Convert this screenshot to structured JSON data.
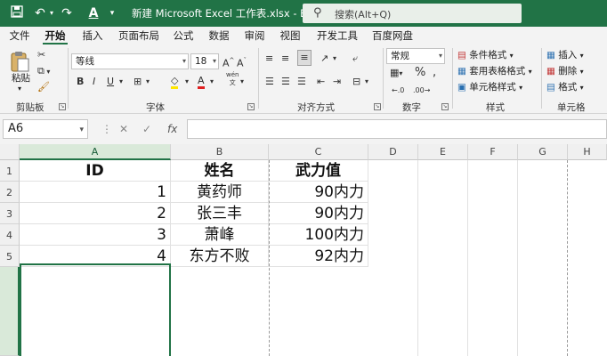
{
  "titlebar": {
    "title": "新建 Microsoft Excel 工作表.xlsx  -  Excel",
    "search_placeholder": "搜索(Alt+Q)",
    "icons": [
      "save-icon",
      "undo-icon",
      "redo-icon",
      "font-color-icon",
      "customize-qat-icon",
      "search-icon"
    ]
  },
  "tabs": [
    "文件",
    "开始",
    "插入",
    "页面布局",
    "公式",
    "数据",
    "审阅",
    "视图",
    "开发工具",
    "百度网盘"
  ],
  "active_tab": "开始",
  "ribbon": {
    "clipboard": {
      "paste": "粘贴",
      "label": "剪贴板"
    },
    "font": {
      "name": "等线",
      "size": "18",
      "label": "字体",
      "wen": "wén"
    },
    "alignment": {
      "label": "对齐方式"
    },
    "number": {
      "format": "常规",
      "label": "数字"
    },
    "styles": {
      "conditional": "条件格式",
      "table": "套用表格格式",
      "cell": "单元格样式",
      "label": "样式"
    },
    "cells": {
      "insert": "插入",
      "delete": "删除",
      "format": "格式",
      "label": "单元格"
    }
  },
  "formula_bar": {
    "name_box": "A6",
    "fx": "fx",
    "cancel": "✕",
    "enter": "✓",
    "value": ""
  },
  "grid": {
    "columns": [
      "A",
      "B",
      "C",
      "D",
      "E",
      "F",
      "G",
      "H"
    ],
    "rows": [
      "1",
      "2",
      "3",
      "4",
      "5"
    ],
    "selected_cell": "A6",
    "headers": [
      "ID",
      "姓名",
      "武力值"
    ],
    "data": [
      [
        "1",
        "黄药师",
        "90内力"
      ],
      [
        "2",
        "张三丰",
        "90内力"
      ],
      [
        "3",
        "萧峰",
        "100内力"
      ],
      [
        "4",
        "东方不败",
        "92内力"
      ]
    ]
  },
  "colors": {
    "accent": "#217346",
    "ribbon_bg": "#f3f3f3"
  }
}
